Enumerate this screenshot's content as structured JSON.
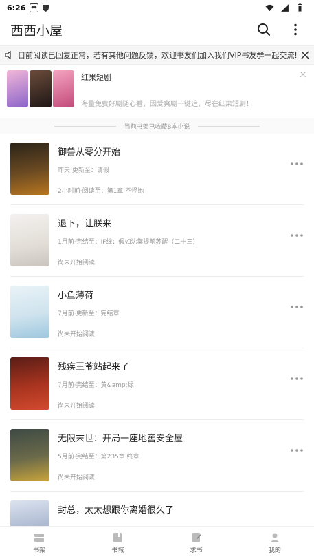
{
  "status_bar": {
    "time": "6:26",
    "left_icons": [
      "panda-app-icon",
      "shield-app-icon"
    ],
    "right_icons": [
      "wifi-icon",
      "signal-icon",
      "battery-icon"
    ]
  },
  "app_bar": {
    "title": "西西小屋",
    "icons": [
      "search-icon",
      "more-vertical-icon"
    ]
  },
  "notice": {
    "text": "目前阅读已回复正常，若有其他问题反馈，欢迎书友们加入我们VIP书友群一起交流!",
    "icons": [
      "speaker-icon",
      "close-icon"
    ]
  },
  "ad": {
    "title": "红果短剧",
    "description": "海量免费好剧随心看，因爱爽剧一键追，尽在红果短剧！",
    "thumb_colors": [
      "#8a63c9",
      "#3b2a2a",
      "#c24a7a"
    ]
  },
  "shelf_stat": {
    "text": "当前书架已收藏8本小说"
  },
  "books": [
    {
      "title": "御兽从零分开始",
      "meta": "昨天·更新至：请假",
      "progress": "2小时前·阅读至：第1章 不怪她",
      "cover_colors": [
        "#2a2318",
        "#b8761f"
      ]
    },
    {
      "title": "退下，让朕来",
      "meta": "1月前·完结至：IF线：假如沈棠提前苏醒（二十三）",
      "progress": "尚未开始阅读",
      "cover_colors": [
        "#f3f1ef",
        "#c9c4bd"
      ]
    },
    {
      "title": "小鱼薄荷",
      "meta": "7月前·更新至：完结章",
      "progress": "尚未开始阅读",
      "cover_colors": [
        "#e9f3f7",
        "#9cc7de"
      ]
    },
    {
      "title": "残疾王爷站起来了",
      "meta": "7月前·完结至：黄&amp;绿",
      "progress": "尚未开始阅读",
      "cover_colors": [
        "#5a1d16",
        "#d24a2e"
      ]
    },
    {
      "title": "无限末世：开局一座地窖安全屋",
      "meta": "5月前·完结至：第235章 终章",
      "progress": "尚未开始阅读",
      "cover_colors": [
        "#3d4a44",
        "#c9a43a"
      ]
    },
    {
      "title": "封总，太太想跟你离婚很久了",
      "meta": "",
      "progress": "",
      "cover_colors": [
        "#dbe3ef",
        "#6d7fa8"
      ]
    }
  ],
  "bottom_nav": [
    {
      "label": "书架",
      "icon": "bookshelf-icon"
    },
    {
      "label": "书城",
      "icon": "bookstore-icon"
    },
    {
      "label": "求书",
      "icon": "request-book-icon"
    },
    {
      "label": "我的",
      "icon": "profile-icon"
    }
  ]
}
